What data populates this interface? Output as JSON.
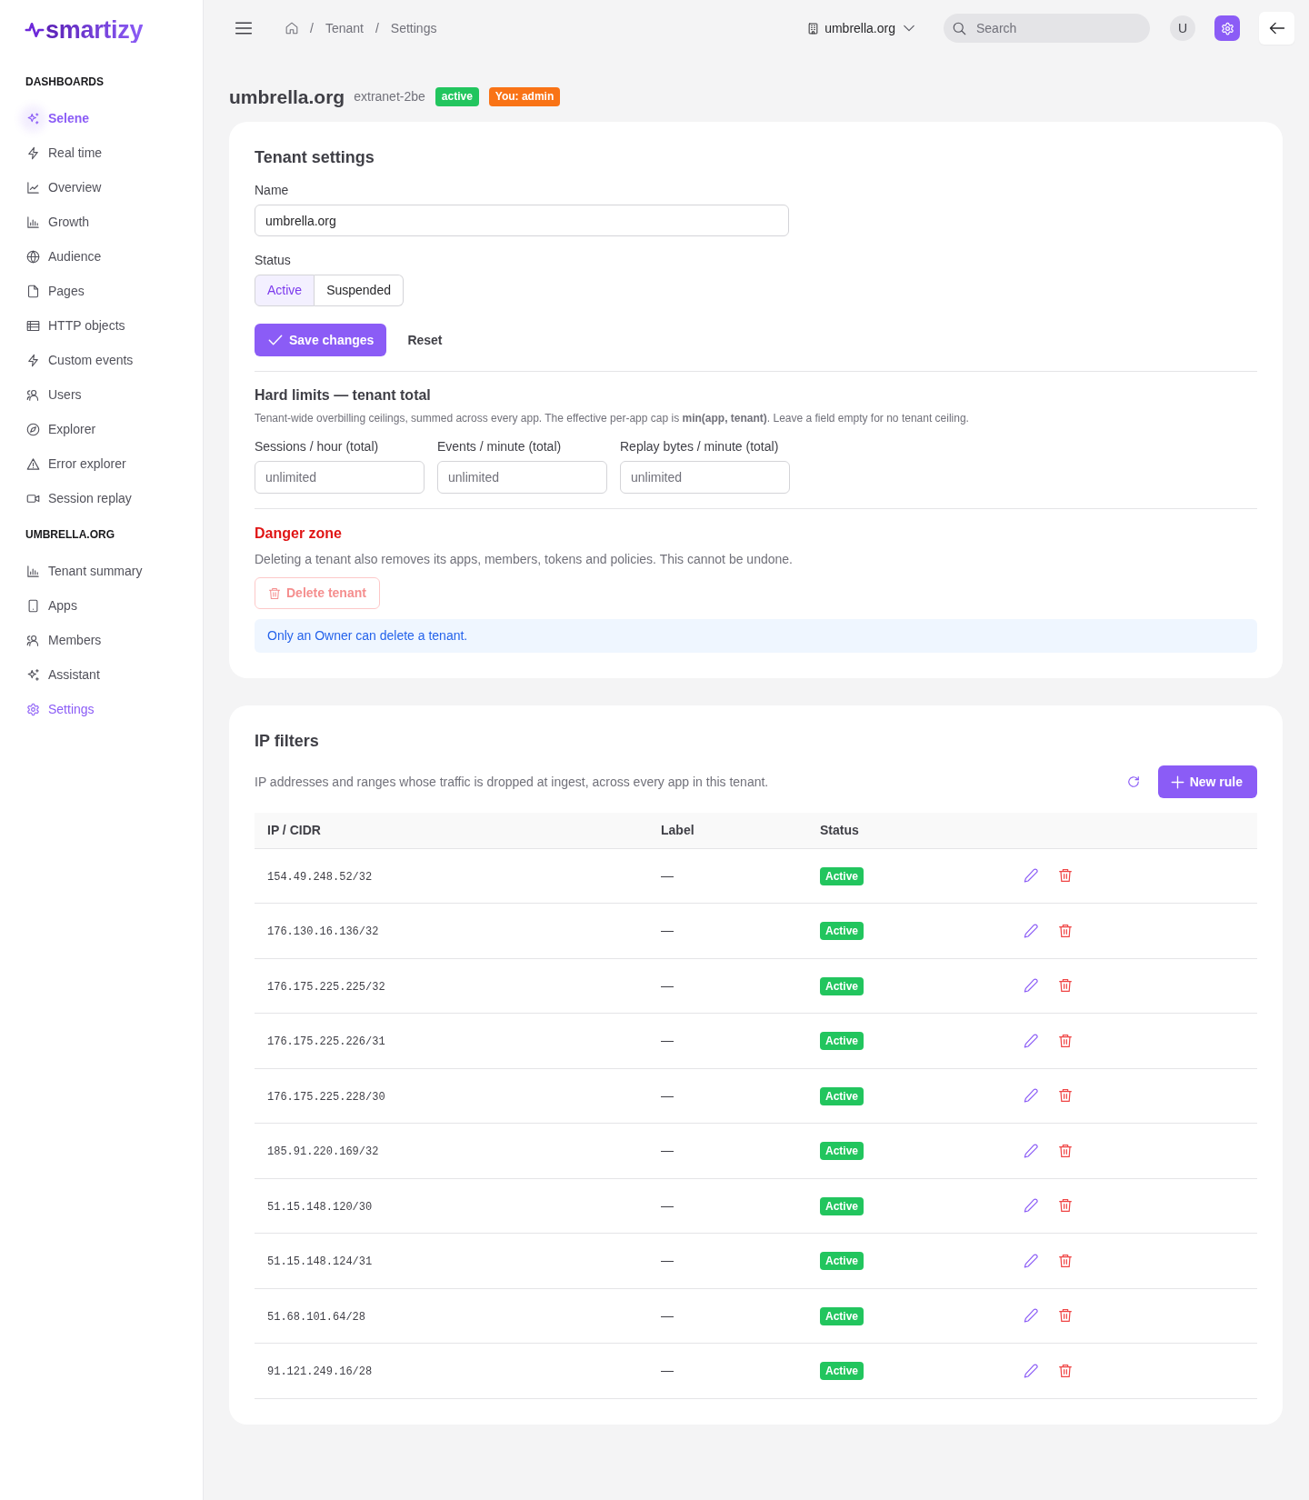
{
  "sidebar": {
    "logo": "smartizy",
    "sections": [
      {
        "heading": "DASHBOARDS",
        "items": [
          {
            "label": "Selene",
            "kind": "featured",
            "selected": false
          },
          {
            "label": "Real time",
            "kind": "link",
            "selected": false
          },
          {
            "label": "Overview",
            "kind": "link",
            "selected": false
          },
          {
            "label": "Growth",
            "kind": "link",
            "selected": false
          },
          {
            "label": "Audience",
            "kind": "link",
            "selected": false
          },
          {
            "label": "Pages",
            "kind": "link",
            "selected": false
          },
          {
            "label": "HTTP objects",
            "kind": "link",
            "selected": false
          },
          {
            "label": "Custom events",
            "kind": "link",
            "selected": false
          },
          {
            "label": "Users",
            "kind": "link",
            "selected": false
          },
          {
            "label": "Explorer",
            "kind": "link",
            "selected": false
          },
          {
            "label": "Error explorer",
            "kind": "link",
            "selected": false
          },
          {
            "label": "Session replay",
            "kind": "link",
            "selected": false
          }
        ]
      },
      {
        "heading": "UMBRELLA.ORG",
        "items": [
          {
            "label": "Tenant summary",
            "kind": "link",
            "selected": false
          },
          {
            "label": "Apps",
            "kind": "link",
            "selected": false
          },
          {
            "label": "Members",
            "kind": "link",
            "selected": false
          },
          {
            "label": "Assistant",
            "kind": "link",
            "selected": false
          },
          {
            "label": "Settings",
            "kind": "link",
            "selected": true
          }
        ]
      }
    ]
  },
  "topbar": {
    "breadcrumb": [
      {
        "kind": "home"
      },
      {
        "kind": "separator",
        "label": "/"
      },
      {
        "kind": "text",
        "label": "Tenant"
      },
      {
        "kind": "separator",
        "label": "/"
      },
      {
        "kind": "text",
        "label": "Settings"
      }
    ],
    "tenant_switcher": "umbrella.org",
    "search": {
      "placeholder": "Search"
    },
    "avatar": "U"
  },
  "header": {
    "title": "umbrella.org",
    "subtitle": "extranet-2be",
    "badges": [
      {
        "label": "active",
        "color": "#22c55e"
      },
      {
        "label": "You: admin",
        "color": "#f97316"
      }
    ]
  },
  "tenant_settings": {
    "title": "Tenant settings",
    "name_field": {
      "label": "Name",
      "value": "umbrella.org"
    },
    "status": {
      "label": "Status",
      "options": [
        {
          "label": "Active",
          "selected": true
        },
        {
          "label": "Suspended",
          "selected": false
        }
      ]
    },
    "actions": [
      {
        "kind": "primary",
        "label": "Save changes"
      },
      {
        "kind": "link",
        "label": "Reset"
      }
    ],
    "hard_limits": {
      "title": "Hard limits — tenant total",
      "description": "Tenant-wide overbilling ceilings, summed across every app. The effective per-app cap is **min(app, tenant)**. Leave a field empty for no tenant ceiling.",
      "fields": [
        {
          "label": "Sessions / hour (total)",
          "placeholder": "unlimited"
        },
        {
          "label": "Events / minute (total)",
          "placeholder": "unlimited"
        },
        {
          "label": "Replay bytes / minute (total)",
          "placeholder": "unlimited"
        }
      ]
    },
    "danger_zone": {
      "title": "Danger zone",
      "description": "Deleting a tenant also removes its apps, members, tokens and policies. This cannot be undone.",
      "button": {
        "label": "Delete tenant",
        "disabled": true
      },
      "notice": "Only an Owner can delete a tenant."
    }
  },
  "ip_filters": {
    "title": "IP filters",
    "description": "IP addresses and ranges whose traffic is dropped at ingest, across every app in this tenant.",
    "new_rule_button": "New rule",
    "table": {
      "columns": [
        "IP / CIDR",
        "Label",
        "Status"
      ],
      "rows": [
        {
          "ip": "154.49.248.52/32",
          "label": "—",
          "status": "Active"
        },
        {
          "ip": "176.130.16.136/32",
          "label": "—",
          "status": "Active"
        },
        {
          "ip": "176.175.225.225/32",
          "label": "—",
          "status": "Active"
        },
        {
          "ip": "176.175.225.226/31",
          "label": "—",
          "status": "Active"
        },
        {
          "ip": "176.175.225.228/30",
          "label": "—",
          "status": "Active"
        },
        {
          "ip": "185.91.220.169/32",
          "label": "—",
          "status": "Active"
        },
        {
          "ip": "51.15.148.120/30",
          "label": "—",
          "status": "Active"
        },
        {
          "ip": "51.15.148.124/31",
          "label": "—",
          "status": "Active"
        },
        {
          "ip": "51.68.101.64/28",
          "label": "—",
          "status": "Active"
        },
        {
          "ip": "91.121.249.16/28",
          "label": "—",
          "status": "Active"
        }
      ]
    }
  }
}
